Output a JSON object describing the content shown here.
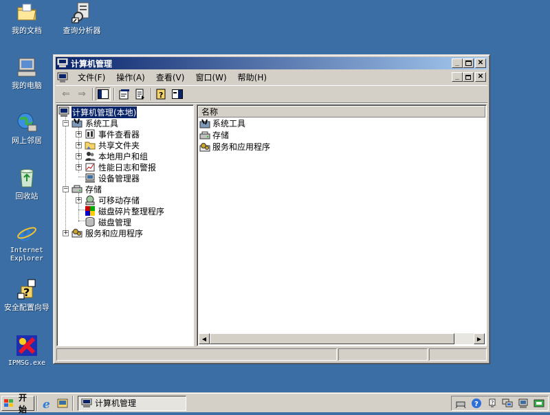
{
  "desktop": {
    "icons": [
      {
        "label": "我的文档"
      },
      {
        "label": "查询分析器"
      },
      {
        "label": "我的电脑"
      },
      {
        "label": "网上邻居"
      },
      {
        "label": "回收站"
      },
      {
        "label": "Internet\nExplorer"
      },
      {
        "label": "安全配置向导"
      },
      {
        "label": "IPMSG.exe"
      }
    ]
  },
  "window": {
    "title": "计算机管理",
    "menu": [
      "文件(F)",
      "操作(A)",
      "查看(V)",
      "窗口(W)",
      "帮助(H)"
    ],
    "tree": [
      {
        "label": "计算机管理(本地)"
      },
      {
        "label": "系统工具"
      },
      {
        "label": "事件查看器"
      },
      {
        "label": "共享文件夹"
      },
      {
        "label": "本地用户和组"
      },
      {
        "label": "性能日志和警报"
      },
      {
        "label": "设备管理器"
      },
      {
        "label": "存储"
      },
      {
        "label": "可移动存储"
      },
      {
        "label": "磁盘碎片整理程序"
      },
      {
        "label": "磁盘管理"
      },
      {
        "label": "服务和应用程序"
      }
    ],
    "list": {
      "column": "名称",
      "items": [
        "系统工具",
        "存储",
        "服务和应用程序"
      ]
    }
  },
  "taskbar": {
    "start_label": "开始",
    "task_label": "计算机管理"
  },
  "colors": {
    "desktop": "#3a6ea5",
    "title_active_start": "#0a246a",
    "title_active_end": "#a6caf0",
    "face": "#d4d0c8"
  }
}
